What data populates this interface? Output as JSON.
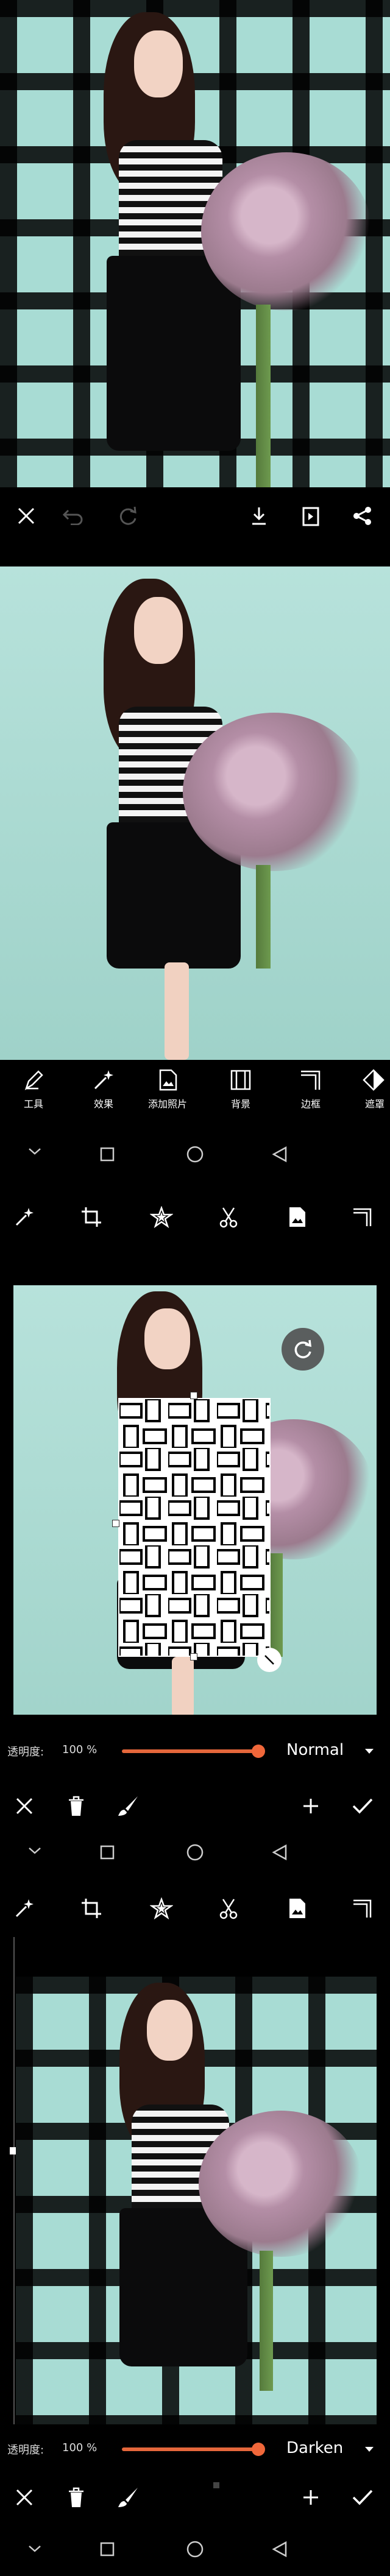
{
  "screen1": {
    "icons": [
      "close-icon",
      "undo-icon",
      "redo-icon",
      "download-icon",
      "export-icon",
      "share-icon"
    ]
  },
  "screen2": {
    "watermark": "",
    "tools": [
      {
        "label": "工具"
      },
      {
        "label": "效果"
      },
      {
        "label": "添加照片"
      },
      {
        "label": "背景"
      },
      {
        "label": "边框"
      },
      {
        "label": "遮罩"
      }
    ]
  },
  "screen3": {
    "opacity_label": "透明度:",
    "opacity_value": "100 %",
    "opacity_fraction": 1.0,
    "blend_mode": "Normal",
    "accent": "#f0673a"
  },
  "screen4": {
    "opacity_label": "透明度:",
    "opacity_value": "100 %",
    "opacity_fraction": 1.0,
    "blend_mode": "Darken"
  }
}
